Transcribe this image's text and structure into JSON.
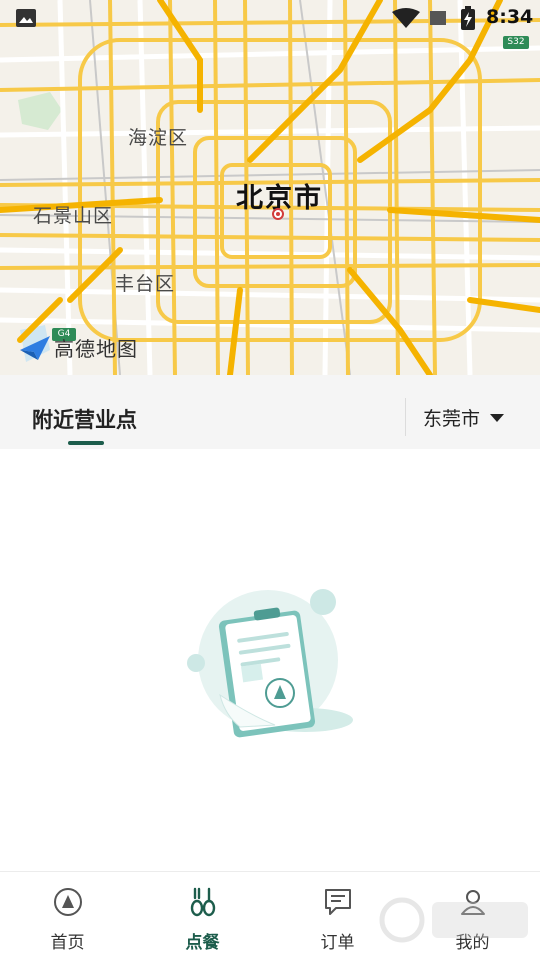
{
  "status_bar": {
    "time": "8:34"
  },
  "map": {
    "city_label": "北京市",
    "district_labels": [
      "海淀区",
      "石景山区",
      "丰台区"
    ],
    "highway_badge": "S32",
    "road_badge": "G4",
    "provider_logo_text": "高德地图"
  },
  "tabs": {
    "nearby_label": "附近营业点",
    "city_select": "东莞市"
  },
  "empty_state": {
    "icon": "clipboard-icon"
  },
  "bottom_nav": {
    "items": [
      {
        "label": "首页",
        "icon": "home-icon",
        "active": false
      },
      {
        "label": "点餐",
        "icon": "order-food-icon",
        "active": true
      },
      {
        "label": "订单",
        "icon": "orders-icon",
        "active": false
      },
      {
        "label": "我的",
        "icon": "profile-icon",
        "active": false
      }
    ]
  },
  "colors": {
    "accent": "#1d5d4c",
    "map_main_road": "#f7c948",
    "map_minor_road": "#ffffff",
    "map_background": "#f4f1ea"
  }
}
